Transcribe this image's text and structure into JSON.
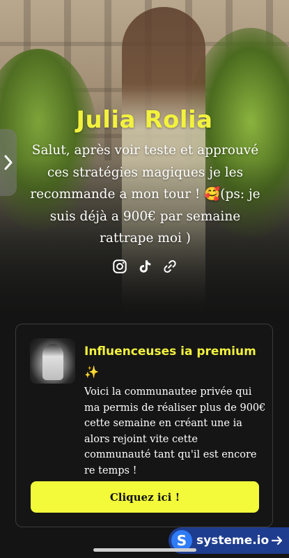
{
  "profile": {
    "name": "Julia Rolia",
    "bio": "Salut, après voir teste et approuvé ces stratégies magiques je les recommande a mon tour ! 🥰(ps: je suis déjà a 900€ par semaine rattrape moi )"
  },
  "socials": [
    "instagram-icon",
    "tiktok-icon",
    "link-icon"
  ],
  "card": {
    "title": "Influenceuses ia premium ✨",
    "text": "Voici la communautee privée qui ma permis de réaliser plus de 900€ cette semaine en créant une ia alors rejoint vite cette communauté tant qu'il est encore re temps !",
    "button_label": "Cliquez ici !"
  },
  "badge": {
    "logo_letter": "S",
    "brand": "systeme.io"
  },
  "colors": {
    "accent_yellow": "#f2f23e",
    "button_yellow": "#f2fa3a",
    "background": "#141414",
    "badge_blue": "#1f3d8f"
  }
}
